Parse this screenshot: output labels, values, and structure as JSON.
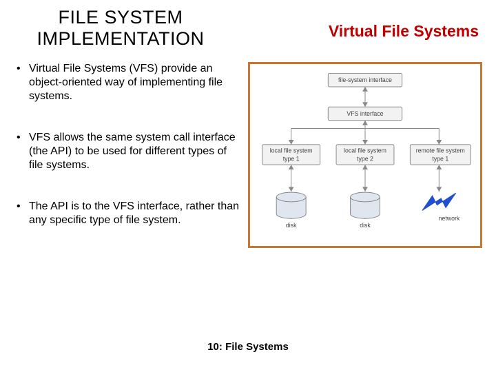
{
  "header": {
    "title_left": "FILE SYSTEM IMPLEMENTATION",
    "title_right": "Virtual File Systems"
  },
  "bullets": [
    "Virtual File Systems (VFS) provide an object-oriented way of implementing file systems.",
    "VFS allows the same system call interface (the API) to be used for different types of file systems.",
    "The API is to the VFS interface, rather than any specific type of file system."
  ],
  "diagram": {
    "top_box": "file-system interface",
    "mid_box": "VFS interface",
    "leaf1_line1": "local file system",
    "leaf1_line2": "type 1",
    "leaf2_line1": "local file system",
    "leaf2_line2": "type 2",
    "leaf3_line1": "remote file system",
    "leaf3_line2": "type 1",
    "disk_label": "disk",
    "network_label": "network"
  },
  "footer": "10: File Systems"
}
